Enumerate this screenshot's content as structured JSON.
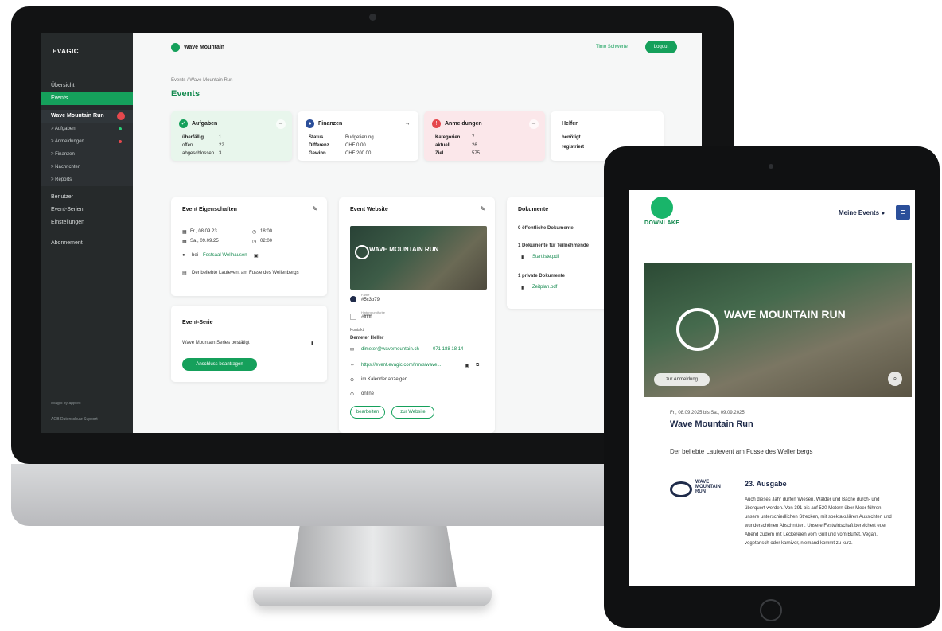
{
  "desktop": {
    "sidebar": {
      "logo": "EVAGIC",
      "items": [
        "Übersicht",
        "Events"
      ],
      "event_name": "Wave Mountain Run",
      "sub_items": [
        "> Aufgaben",
        "> Anmeldungen",
        "> Finanzen",
        "> Nachrichten",
        "> Reports"
      ],
      "items2": [
        "Benutzer",
        "Event-Serien",
        "Einstellungen",
        "Abonnement"
      ],
      "footer1": "evagic by apptec",
      "footer2": "AGB  Datenschutz  Support"
    },
    "topbar": {
      "brand": "Wave Mountain",
      "user": "Timo Schwerte",
      "logout": "Logout"
    },
    "breadcrumb": "Events / Wave Mountain Run",
    "page_title": "Events",
    "aufgaben": {
      "title": "Aufgaben",
      "rows": [
        [
          "überfällig",
          "1"
        ],
        [
          "offen",
          "22"
        ],
        [
          "abgeschlossen",
          "3"
        ]
      ]
    },
    "finanzen": {
      "title": "Finanzen",
      "rows": [
        [
          "Status",
          "Budgetierung"
        ],
        [
          "Differenz",
          "CHF 0.00"
        ],
        [
          "Gewinn",
          "CHF 200.00"
        ]
      ]
    },
    "anmeldungen": {
      "title": "Anmeldungen",
      "rows": [
        [
          "Kategorien",
          "7"
        ],
        [
          "aktuell",
          "26"
        ],
        [
          "Ziel",
          "575"
        ]
      ]
    },
    "helfer": {
      "title": "Helfer",
      "rows": [
        [
          "benötigt",
          "..."
        ],
        [
          "registriert",
          "..."
        ]
      ]
    },
    "eigenschaften": {
      "title": "Event Eigenschaften",
      "date_from": "Fr., 08.09.23",
      "time_from": "18:00",
      "date_to": "Sa., 09.09.25",
      "time_to": "02:00",
      "location_prefix": "bei",
      "location": "Festsaal Wellhausen",
      "description": "Der beliebte Laufevent am Fusse des Wellenbergs"
    },
    "serie": {
      "title": "Event-Serie",
      "text": "Wave Mountain Series bestätigt",
      "button": "Anschluss beantragen"
    },
    "website": {
      "title": "Event Website",
      "hero_text": "WAVE MOUNTAIN RUN",
      "color1_label": "Farbe",
      "color1": "#5c3b79",
      "color2_label": "Hintergrundfarbe",
      "color2": "#ffffff",
      "contact_label": "Kontakt",
      "contact_name": "Demeter Heller",
      "email": "dimeter@wavemountain.ch",
      "phone": "071 188 18 14",
      "url": "https://event.evagic.com/frm/s/wave...",
      "calendar": "im Kalender anzeigen",
      "online": "online",
      "btn_edit": "bearbeiten",
      "btn_site": "zur Website"
    },
    "dokumente": {
      "title": "Dokumente",
      "public": "0 öffentliche Dokumente",
      "participants": "1 Dokumente für Teilnehmende",
      "file1": "Startliste.pdf",
      "private": "1 private Dokumente",
      "file2": "Zeitplan.pdf"
    }
  },
  "tablet": {
    "brand": "DOWNLAKE",
    "my_events": "Meine Events",
    "hero_text": "WAVE MOUNTAIN RUN",
    "register": "zur Anmeldung",
    "date_range": "Fr., 08.09.2025 bis Sa., 09.09.2025",
    "title": "Wave Mountain Run",
    "description": "Der beliebte Laufevent am Fusse des Wellenbergs",
    "logo_text": "WAVE MOUNTAIN RUN",
    "edition": "23. Ausgabe",
    "body": "Auch dieses Jahr dürfen Wiesen, Wälder und Bäche durch- und überquert werden. Von 391 bis auf 520 Metern über Meer führen unsere unterschiedlichen Strecken, mit spektakulären Aussichten und wunderschönen Abschnitten. Unsere Festwirtschaft bereichert euer Abend zudem mit Leckereien vom Grill und vom Buffet. Vegan, vegetarisch oder karnivor, niemand kommt zu kurz."
  },
  "colors": {
    "accent": "#15a05b",
    "sidebar": "#262a2b",
    "navy": "#1f2b4a"
  }
}
